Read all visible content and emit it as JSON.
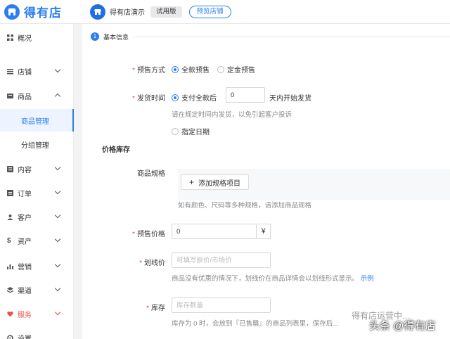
{
  "header": {
    "brand": "得有店",
    "store_name": "得有店演示",
    "trial_badge": "试用版",
    "preview_button": "预览店铺"
  },
  "sidebar": {
    "items": [
      {
        "label": "概况",
        "icon": "grid-icon"
      },
      {
        "label": "店铺",
        "icon": "store-icon"
      },
      {
        "label": "商品",
        "icon": "goods-icon"
      },
      {
        "label": "商品管理"
      },
      {
        "label": "分组管理"
      },
      {
        "label": "内容",
        "icon": "content-icon"
      },
      {
        "label": "订单",
        "icon": "order-icon"
      },
      {
        "label": "客户",
        "icon": "customer-icon"
      },
      {
        "label": "资产",
        "icon": "dollar-icon"
      },
      {
        "label": "营销",
        "icon": "chart-icon"
      },
      {
        "label": "渠道",
        "icon": "channel-icon"
      },
      {
        "label": "服务",
        "icon": "heart-icon"
      },
      {
        "label": "设置",
        "icon": "settings-icon"
      }
    ],
    "active_color": "#2a7ef1",
    "highlight_color": "#e8504a"
  },
  "step": {
    "number": "1",
    "label": "基本信息"
  },
  "form": {
    "presale_mode_label": "预售方式",
    "presale_options": [
      "全款预售",
      "定金预售"
    ],
    "ship_time_label": "发货时间",
    "ship_option_after_pay": "支付全款后",
    "ship_days_value": "0",
    "ship_days_suffix": "天内开始发货",
    "ship_hint": "请在规定时间内发货，以免引起客户投诉",
    "ship_option_date": "指定日期",
    "section_price_stock": "价格库存",
    "spec_label": "商品规格",
    "add_spec_button": "添加规格项目",
    "spec_hint": "如有颜色、尺码等多种规格，请添加商品规格",
    "presale_price_label": "预售价格",
    "presale_price_value": "0",
    "currency_symbol": "¥",
    "strike_price_label": "划线价",
    "strike_price_placeholder": "可填写原价/市场价",
    "strike_price_hint": "商品没有优惠的情况下，划线价在商品详情会以划线形式显示。",
    "strike_price_example": "示例",
    "stock_label": "库存",
    "stock_placeholder": "库存数量",
    "stock_hint": "库存为 0 时，会放到『已售罄』的商品列表里，保存后…"
  },
  "watermark": {
    "line1": "得有店运营中…",
    "line2": "头条 @得有店"
  }
}
